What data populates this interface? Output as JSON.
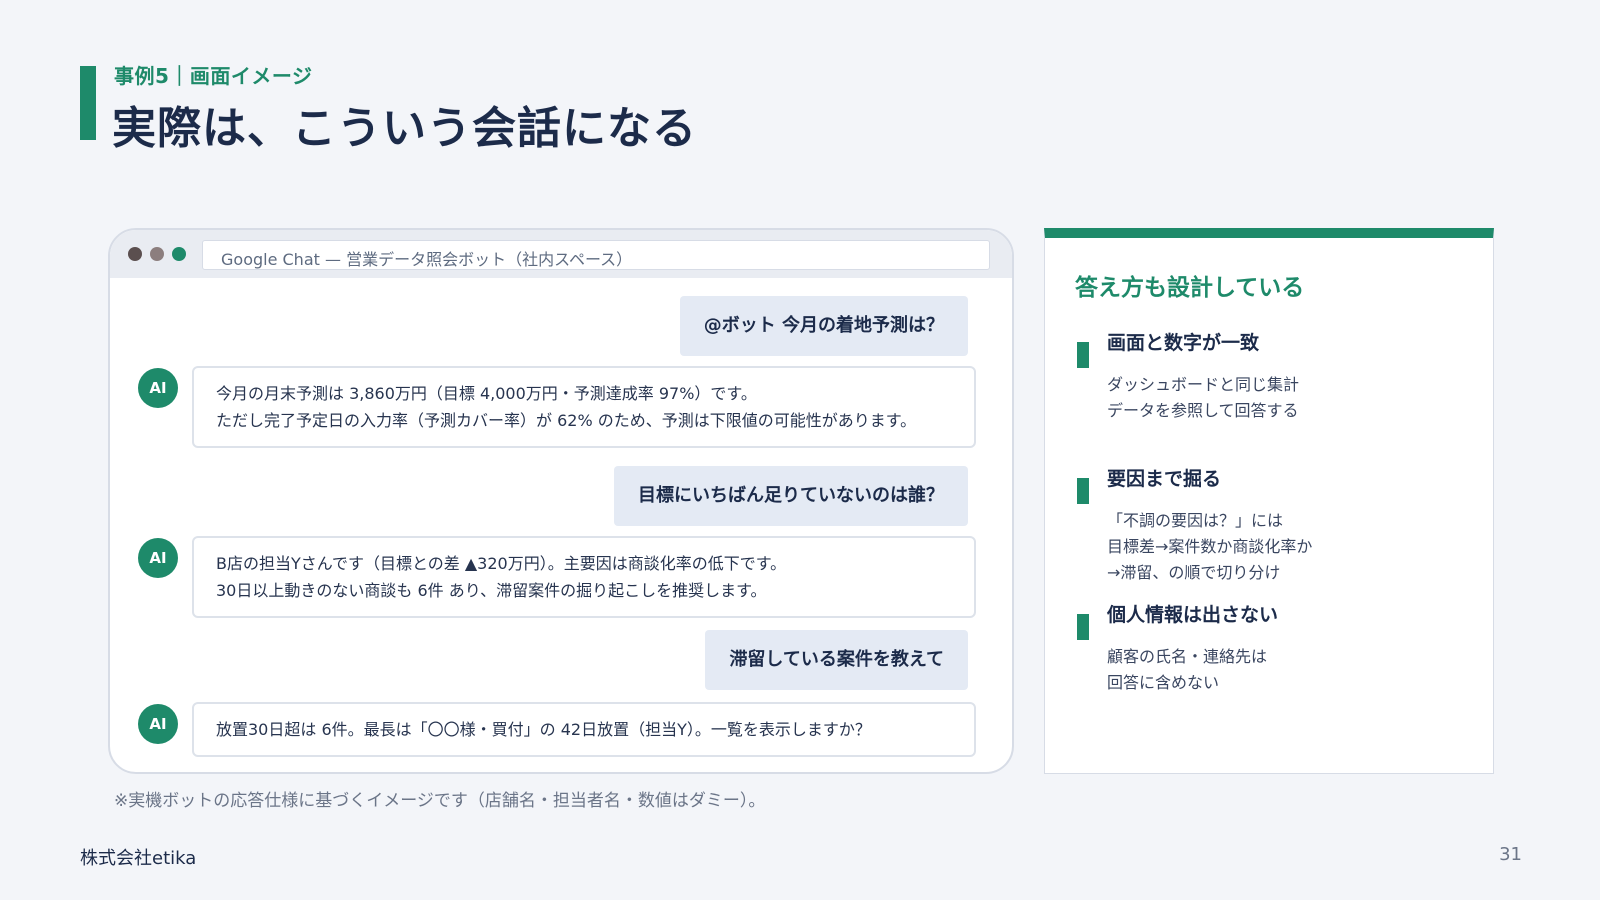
{
  "header": {
    "eyebrow": "事例5｜画面イメージ",
    "title": "実際は、こういう会話になる"
  },
  "chat": {
    "window_title": "Google Chat — 営業データ照会ボット（社内スペース）",
    "avatar_label": "AI",
    "messages": [
      {
        "role": "user",
        "text": "@ボット 今月の着地予測は？"
      },
      {
        "role": "bot",
        "lines": [
          "今月の月末予測は 3,860万円（目標 4,000万円・予測達成率 97%）です。",
          "ただし完了予定日の入力率（予測カバー率）が 62% のため、予測は下限値の可能性があります。"
        ]
      },
      {
        "role": "user",
        "text": "目標にいちばん足りていないのは誰？"
      },
      {
        "role": "bot",
        "lines": [
          "B店の担当Yさんです（目標との差 ▲320万円）。主要因は商談化率の低下です。",
          "30日以上動きのない商談も 6件 あり、滞留案件の掘り起こしを推奨します。"
        ]
      },
      {
        "role": "user",
        "text": "滞留している案件を教えて"
      },
      {
        "role": "bot",
        "lines": [
          "放置30日超は 6件。最長は「〇〇様・買付」の 42日放置（担当Y）。一覧を表示しますか？"
        ]
      }
    ]
  },
  "footnote": "※実機ボットの応答仕様に基づくイメージです（店舗名・担当者名・数値はダミー）。",
  "side": {
    "title": "答え方も設計している",
    "points": [
      {
        "heading": "画面と数字が一致",
        "lines": [
          "ダッシュボードと同じ集計",
          "データを参照して回答する"
        ]
      },
      {
        "heading": "要因まで掘る",
        "lines": [
          "「不調の要因は？」には",
          "目標差→案件数か商談化率か",
          "→滞留、の順で切り分け"
        ]
      },
      {
        "heading": "個人情報は出さない",
        "lines": [
          "顧客の氏名・連絡先は",
          "回答に含めない"
        ]
      }
    ]
  },
  "footer": {
    "company": "株式会社etika",
    "page": "31"
  },
  "colors": {
    "accent": "#1e8a6a",
    "navy": "#1c2b4a",
    "background": "#f3f5f9"
  }
}
